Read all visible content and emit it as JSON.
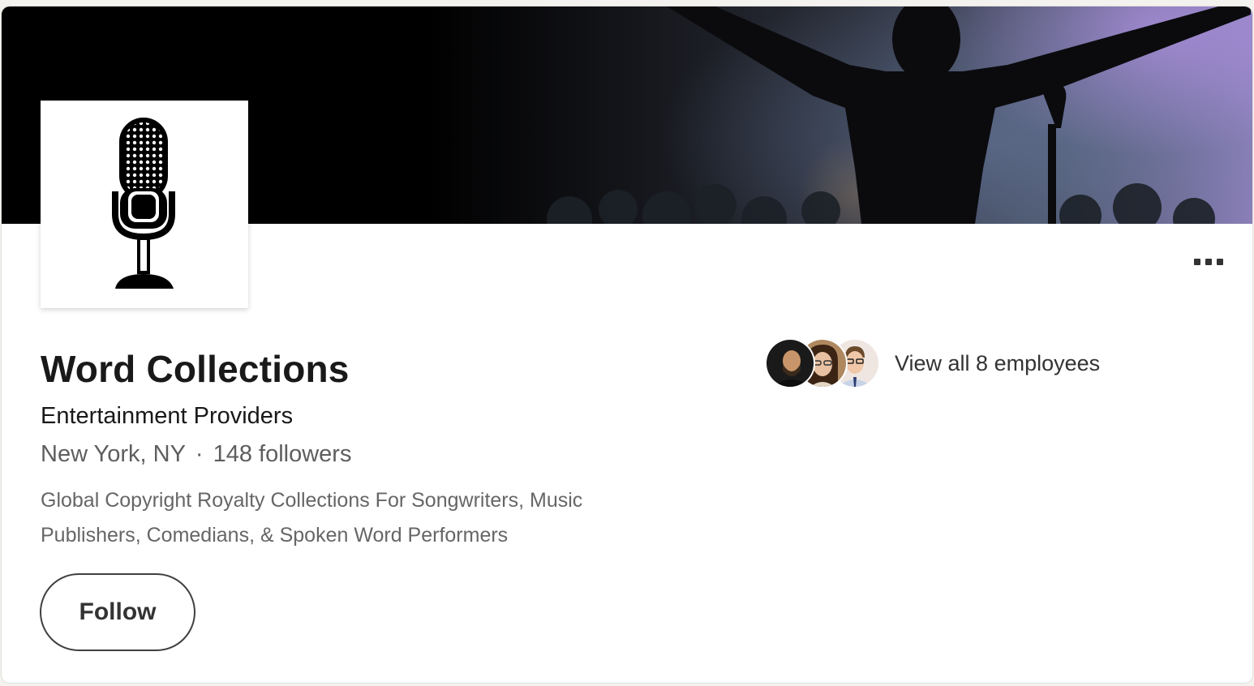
{
  "company": {
    "name": "Word Collections",
    "industry": "Entertainment Providers",
    "location": "New York, NY",
    "separator": "·",
    "followers": "148 followers",
    "tagline": "Global Copyright Royalty Collections For Songwriters, Music Publishers, Comedians, & Spoken Word Performers"
  },
  "actions": {
    "follow_label": "Follow",
    "more_icon": "ellipsis-icon"
  },
  "employees": {
    "link_text": "View all 8 employees",
    "avatar_count": 3
  },
  "images": {
    "cover": "performer-silhouette-with-microphone",
    "logo": "vintage-microphone-icon"
  },
  "colors": {
    "text_primary": "#191919",
    "text_secondary": "#5e5e5e",
    "button_border": "#404040"
  }
}
